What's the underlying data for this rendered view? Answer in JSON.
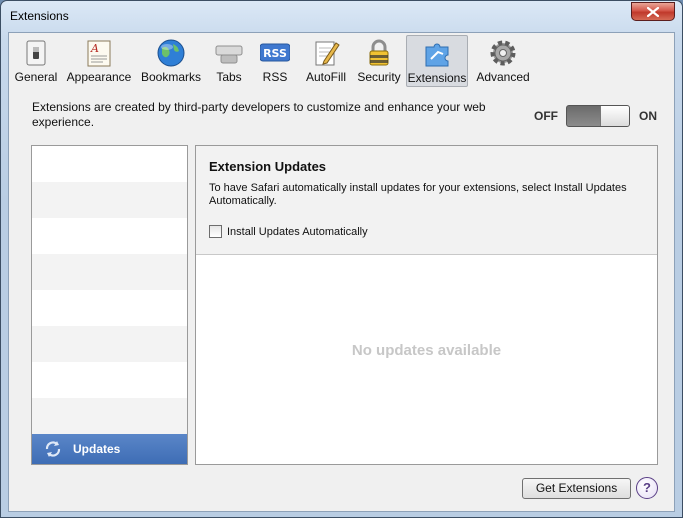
{
  "window": {
    "title": "Extensions"
  },
  "toolbar": {
    "items": [
      {
        "label": "General",
        "icon": "switch-icon"
      },
      {
        "label": "Appearance",
        "icon": "appearance-icon"
      },
      {
        "label": "Bookmarks",
        "icon": "globe-icon"
      },
      {
        "label": "Tabs",
        "icon": "tabs-icon"
      },
      {
        "label": "RSS",
        "icon": "rss-icon"
      },
      {
        "label": "AutoFill",
        "icon": "pencil-icon"
      },
      {
        "label": "Security",
        "icon": "lock-icon"
      },
      {
        "label": "Extensions",
        "icon": "puzzle-icon",
        "selected": true
      },
      {
        "label": "Advanced",
        "icon": "gear-icon"
      }
    ]
  },
  "description": "Extensions are created by third-party developers to customize and enhance your web experience.",
  "toggle": {
    "off_label": "OFF",
    "on_label": "ON",
    "state": "off"
  },
  "sidebar": {
    "selected_label": "Updates"
  },
  "panel": {
    "title": "Extension Updates",
    "text": "To have Safari automatically install updates for your extensions, select Install Updates Automatically.",
    "checkbox_label": "Install Updates Automatically",
    "checkbox_checked": false,
    "empty_message": "No updates available"
  },
  "buttons": {
    "get_extensions": "Get Extensions",
    "help": "?"
  },
  "icons": {
    "rss_text": "RSS"
  },
  "colors": {
    "selection_blue": "#4a78bd",
    "close_red": "#c0392b"
  }
}
